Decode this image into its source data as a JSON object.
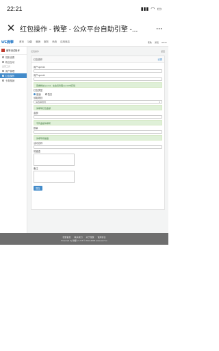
{
  "status_bar": {
    "time": "22:21",
    "signal": "▮▮▮",
    "wifi": "◠",
    "battery": "▭"
  },
  "browser": {
    "close": "✕",
    "title": "红包操作 - 微擎 - 公众平台自助引擎 -...",
    "more": "···"
  },
  "topnav": {
    "logo": "WE微擎",
    "links": [
      "首页",
      "功能",
      "营销",
      "服务",
      "系统",
      "应用商店"
    ],
    "right": [
      "帮助",
      "通知",
      "admin"
    ]
  },
  "sidebar": {
    "account": "微擎测试账号",
    "items": [
      "规则设置",
      "粉丝互动"
    ],
    "group": "运营工具",
    "subitems": [
      "用户管理",
      "红包操作",
      "卡券核销"
    ],
    "active_index": 1
  },
  "main": {
    "head_left": "红包操作",
    "head_right": "返回",
    "panel_title": "红包操作",
    "panel_link": "设置",
    "labels": {
      "openid": "用户openid",
      "nick": "用户openid",
      "type": "红包类型",
      "rule": "领取规则",
      "money": "金额",
      "count": "数量",
      "wish": "祝福语",
      "act": "活动名称",
      "remark": "备注"
    },
    "type_options": [
      "普通",
      "裂变"
    ],
    "type_selected": 0,
    "rule_select": "请选择规则",
    "tips": [
      "查看粉丝openid，在会员管理openid中获得",
      "请填写红包金额",
      "不同金额请填写",
      "请填写祝福语"
    ],
    "submit": "提交"
  },
  "footer": {
    "links": [
      "微擎首页",
      "联系我们",
      "关于微擎",
      "使用协议"
    ],
    "copy": "Powered by 微擎 v1.7.8 © 2014-2018 www.we7.cc"
  }
}
